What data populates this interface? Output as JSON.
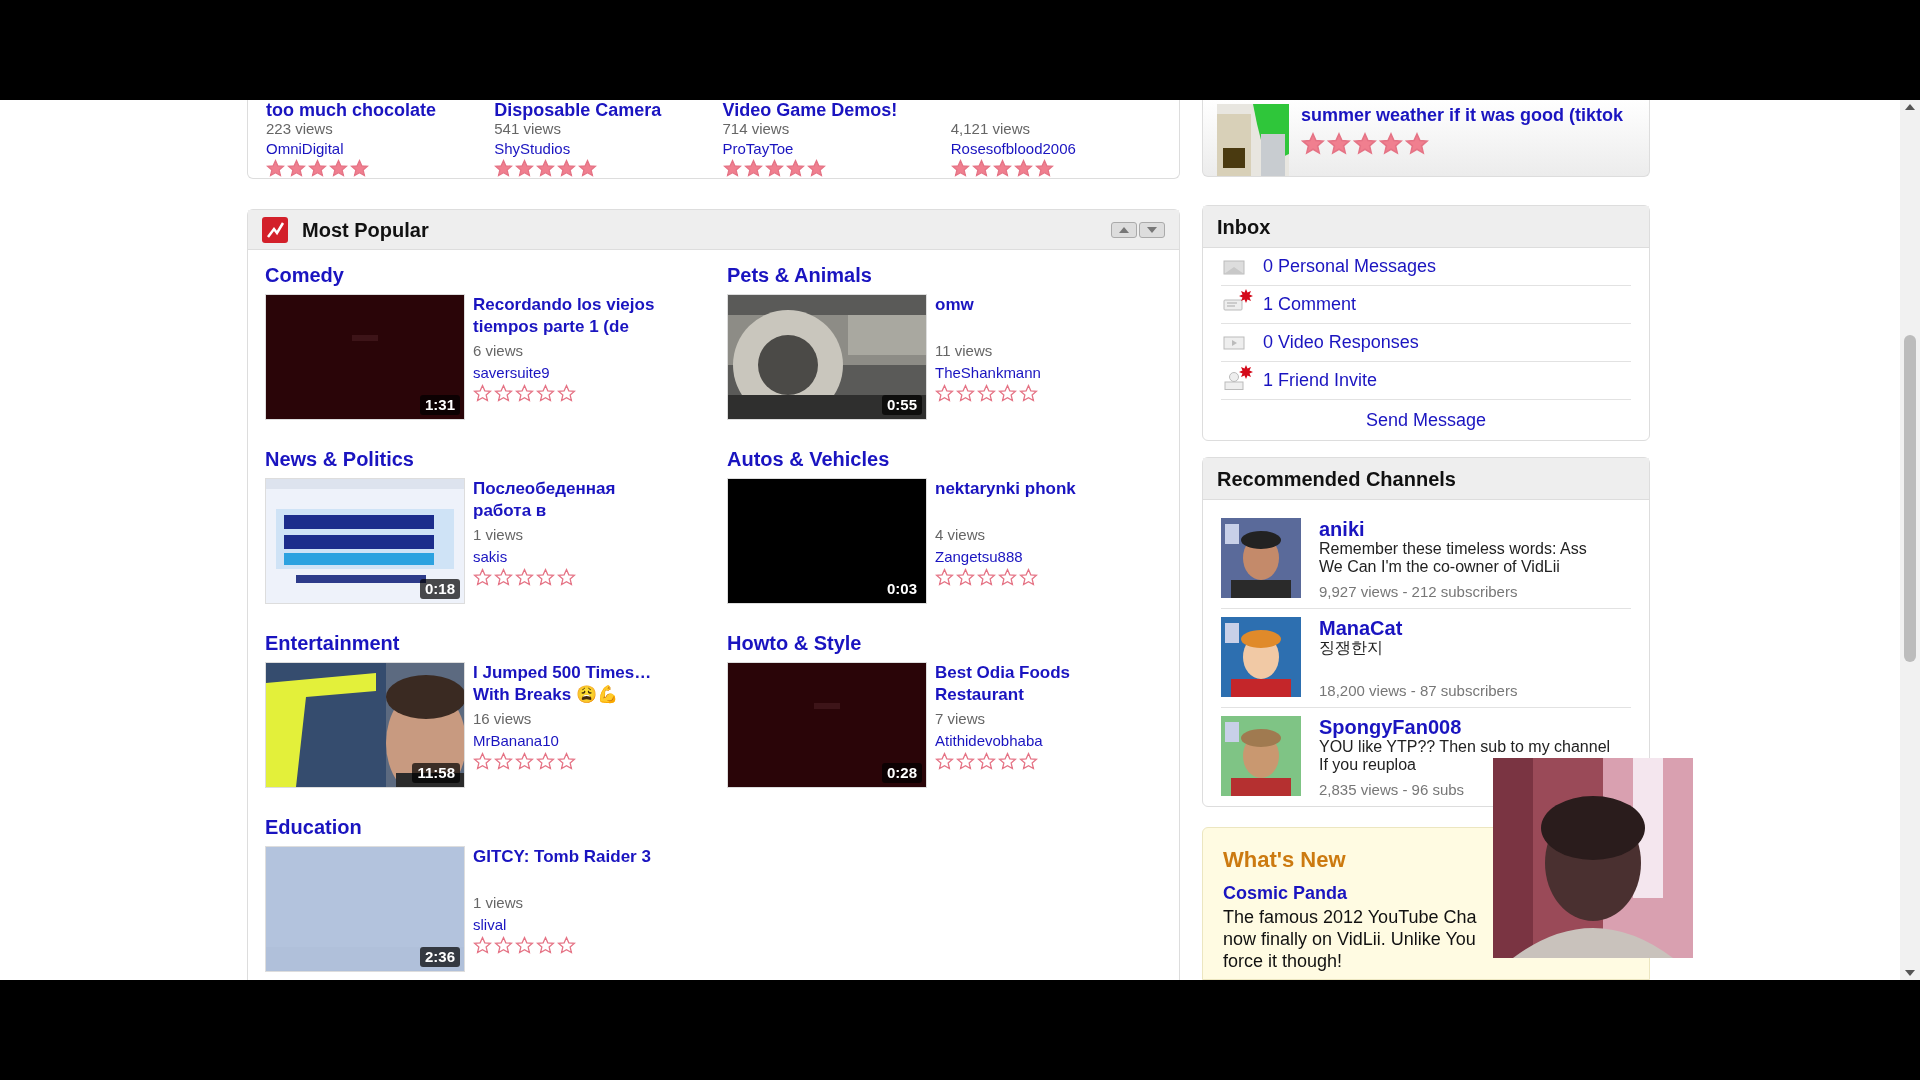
{
  "recent_videos": [
    {
      "title": "too much chocolate",
      "views": "223 views",
      "user": "OmniDigital",
      "stars": 5
    },
    {
      "title": "Disposable Camera",
      "views": "541 views",
      "user": "ShyStudios",
      "stars": 5
    },
    {
      "title": "Video Game Demos!",
      "views": "714 views",
      "user": "ProTayToe",
      "stars": 5
    },
    {
      "views": "4,121 views",
      "user": "Rosesofblood2006",
      "stars": 5
    }
  ],
  "most_popular": {
    "title": "Most Popular",
    "categories": [
      {
        "name": "Comedy",
        "video": {
          "title": "Recordando los viejos tiempos parte 1 (de",
          "views": "6 views",
          "user": "saversuite9",
          "duration": "1:31",
          "stars": 0,
          "kind": "dark"
        }
      },
      {
        "name": "Pets & Animals",
        "video": {
          "title": "omw",
          "views": "11 views",
          "user": "TheShankmann",
          "duration": "0:55",
          "stars": 0,
          "kind": "picture"
        }
      },
      {
        "name": "News & Politics",
        "video": {
          "title": "Послеобеденная работа в",
          "views": "1 views",
          "user": "sakis",
          "duration": "0:18",
          "stars": 0,
          "kind": "picture"
        }
      },
      {
        "name": "Autos & Vehicles",
        "video": {
          "title": "nektarynki phonk",
          "views": "4 views",
          "user": "Zangetsu888",
          "duration": "0:03",
          "stars": 0,
          "kind": "dark"
        }
      },
      {
        "name": "Entertainment",
        "video": {
          "title": "I Jumped 500 Times… With Breaks 😩💪",
          "views": "16 views",
          "user": "MrBanana10",
          "duration": "11:58",
          "stars": 0,
          "kind": "picture"
        }
      },
      {
        "name": "Howto & Style",
        "video": {
          "title": "Best Odia Foods Restaurant",
          "views": "7 views",
          "user": "Atithidevobhaba",
          "duration": "0:28",
          "stars": 0,
          "kind": "dark"
        }
      },
      {
        "name": "Education",
        "video": {
          "title": "GITCY:   Tomb Raider 3",
          "views": "1 views",
          "user": "slival",
          "duration": "2:36",
          "stars": 0,
          "kind": "pale"
        }
      }
    ]
  },
  "featured": {
    "title": "summer weather if it was good (tiktok",
    "stars": 5
  },
  "inbox": {
    "title": "Inbox",
    "items": [
      {
        "kind": "message",
        "label": "0 Personal Messages",
        "alert": false
      },
      {
        "kind": "comment",
        "label": "1 Comment",
        "alert": true
      },
      {
        "kind": "video",
        "label": "0 Video Responses",
        "alert": false
      },
      {
        "kind": "friend",
        "label": "1 Friend Invite",
        "alert": true
      }
    ],
    "action": "Send Message"
  },
  "recommended_channels": {
    "title": "Recommended Channels",
    "channels": [
      {
        "name": "aniki",
        "description": "Remember these timeless words: Ass We Can I'm the co-owner of VidLii",
        "stats": "9,927 views - 212 subscribers"
      },
      {
        "name": "ManaCat",
        "description": "징쟁한지",
        "stats": "18,200 views - 87 subscribers"
      },
      {
        "name": "SpongyFan008",
        "description": "YOU like YTP?? Then sub to my channel If you reuploa",
        "stats": "2,835 views - 96 subs"
      }
    ]
  },
  "whats_new": {
    "title": "What's New",
    "item_title": "Cosmic Panda",
    "body_lines": [
      "The famous 2012 YouTube Cha",
      "now finally on VidLii. Unlike You",
      "force it though!"
    ]
  }
}
